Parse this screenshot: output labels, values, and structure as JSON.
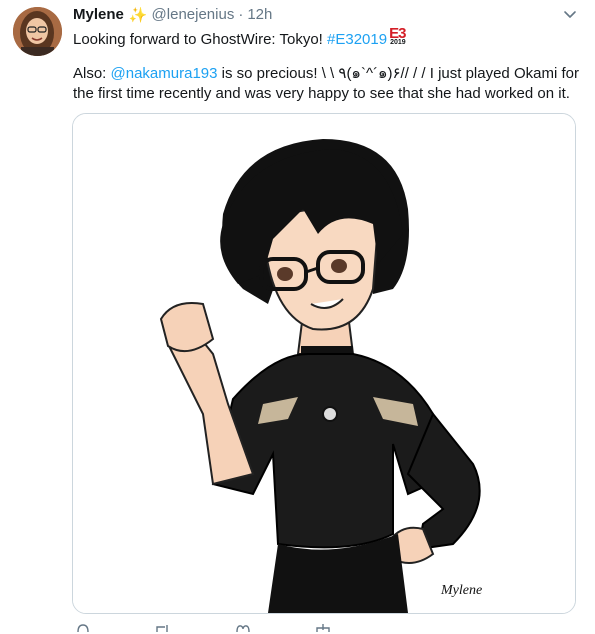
{
  "tweet": {
    "author_name": "Mylene",
    "sparkle": "✨",
    "handle": "@lenejenius",
    "separator": "·",
    "time": "12h",
    "line1_text": "Looking forward to GhostWire: Tokyo! ",
    "line1_hashtag": "#E32019",
    "e3_badge_big": "E3",
    "e3_badge_small": "2019",
    "para_prefix": "Also: ",
    "para_mention": "@nakamura193",
    "para_text": " is so precious!  \\ \\ ٩(๑`^´๑)۶// / /  I just played Okami for the first time recently and was very happy to see that she had worked on it.",
    "signature": "Mylene"
  },
  "icons": {
    "avatar": "avatar-photo",
    "caret": "chevron-down-icon",
    "actions": [
      "reply-icon",
      "retweet-icon",
      "like-icon",
      "share-icon"
    ]
  },
  "colors": {
    "link": "#1da1f2",
    "muted": "#657786",
    "text": "#14171a",
    "border": "#ccd6dd"
  }
}
